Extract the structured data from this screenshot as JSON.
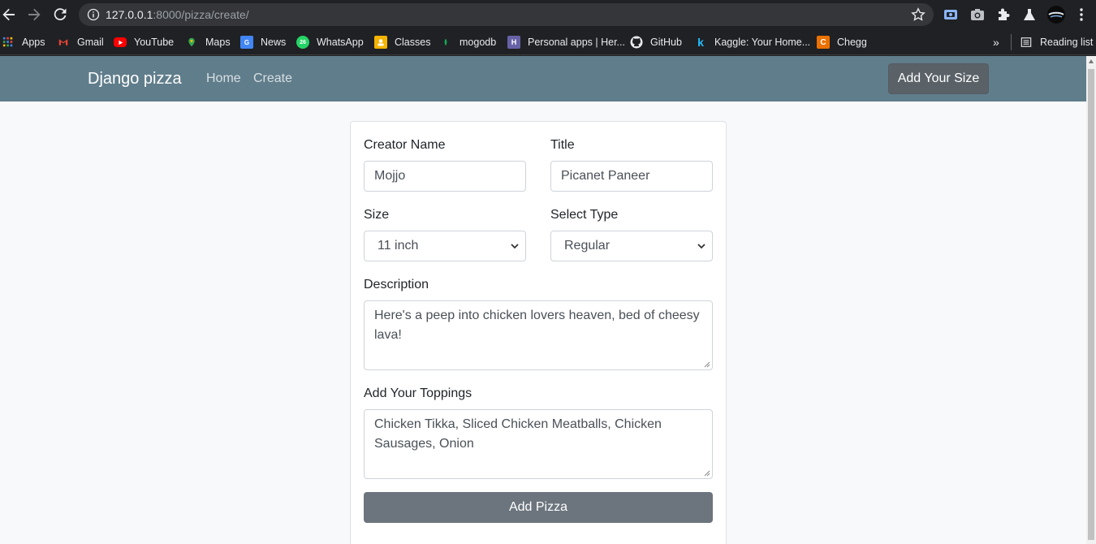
{
  "browser": {
    "url_host": "127.0.0.1",
    "url_path": ":8000/pizza/create/",
    "reading_list_label": "Reading list",
    "bookmarks": [
      {
        "label": "Apps",
        "icon": "apps-grid-icon",
        "color": "#4285f4"
      },
      {
        "label": "Gmail",
        "icon": "gmail-icon",
        "color": "#ea4335"
      },
      {
        "label": "YouTube",
        "icon": "youtube-icon",
        "color": "#ff0000"
      },
      {
        "label": "Maps",
        "icon": "maps-icon",
        "color": "#34a853"
      },
      {
        "label": "News",
        "icon": "news-icon",
        "color": "#4285f4"
      },
      {
        "label": "WhatsApp",
        "icon": "whatsapp-icon",
        "color": "#25d366"
      },
      {
        "label": "Classes",
        "icon": "classes-icon",
        "color": "#f4b400"
      },
      {
        "label": "mogodb",
        "icon": "mongodb-leaf-icon",
        "color": "#13aa52"
      },
      {
        "label": "Personal apps | Her...",
        "icon": "heroku-icon",
        "color": "#6762a6"
      },
      {
        "label": "GitHub",
        "icon": "github-icon",
        "color": "#ffffff"
      },
      {
        "label": "Kaggle: Your Home...",
        "icon": "kaggle-icon",
        "color": "#20beff"
      },
      {
        "label": "Chegg",
        "icon": "chegg-icon",
        "color": "#eb7100"
      }
    ]
  },
  "navbar": {
    "brand": "Django pizza",
    "links": [
      "Home",
      "Create"
    ],
    "add_size_label": "Add Your Size",
    "bg_color": "#607d8b"
  },
  "form": {
    "creator_label": "Creator Name",
    "creator_value": "Mojjo",
    "title_label": "Title",
    "title_value": "Picanet Paneer",
    "size_label": "Size",
    "size_value": "11 inch",
    "type_label": "Select Type",
    "type_value": "Regular",
    "description_label": "Description",
    "description_value": "Here's a peep into chicken lovers heaven, bed of cheesy lava!",
    "toppings_label": "Add Your Toppings",
    "toppings_value": "Chicken Tikka, Sliced Chicken Meatballs, Chicken Sausages, Onion",
    "submit_label": "Add Pizza"
  }
}
